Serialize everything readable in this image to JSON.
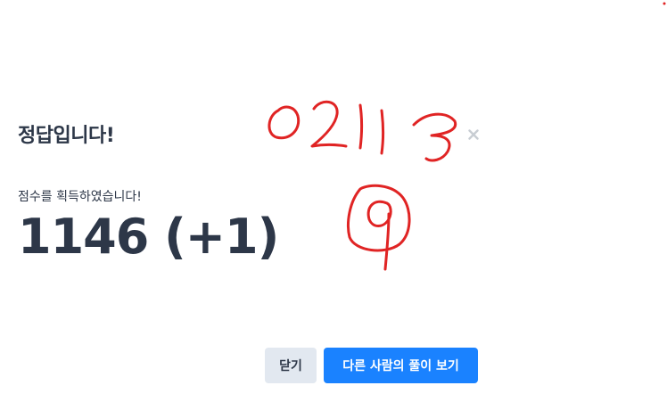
{
  "modal": {
    "title": "정답입니다!",
    "subtitle": "점수를 획득하였습니다!",
    "score": "1146 (+1)",
    "close_icon": "close-icon",
    "buttons": {
      "close_label": "닫기",
      "view_others_label": "다른 사람의 풀이 보기"
    }
  },
  "colors": {
    "primary": "#1a82ff",
    "secondary_bg": "#e2e8f0",
    "text": "#2d3748",
    "annotation": "#e02424"
  }
}
